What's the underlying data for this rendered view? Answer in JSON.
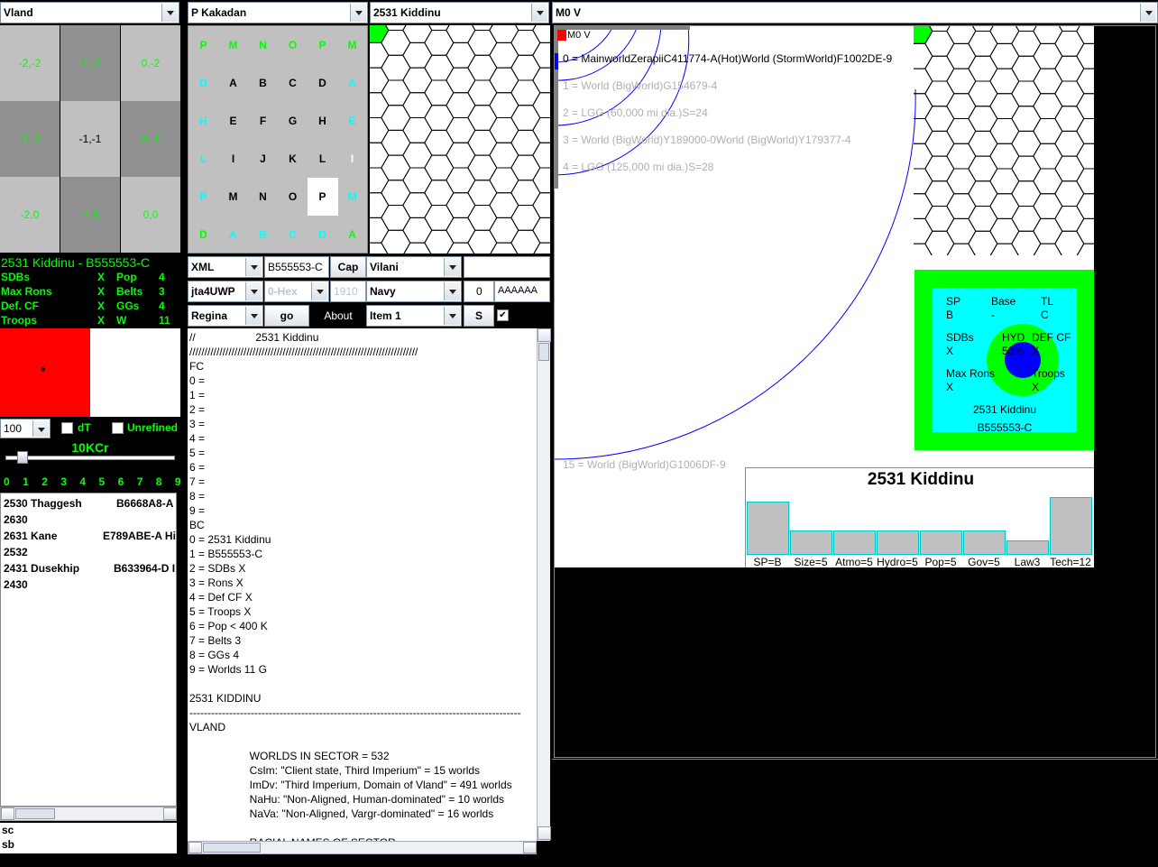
{
  "combos": {
    "sector": "Vland",
    "subsector": "P Kakadan",
    "hex": "2531 Kiddinu",
    "star": "M0 V"
  },
  "grid9": [
    {
      "label": "-2,-2",
      "color": "#00ff00",
      "bg": "#c0c0c0"
    },
    {
      "label": "-1,-2",
      "color": "#00ff00",
      "bg": "#909090"
    },
    {
      "label": "0,-2",
      "color": "#00ff00",
      "bg": "#c0c0c0"
    },
    {
      "label": "-2,-1",
      "color": "#00ff00",
      "bg": "#909090"
    },
    {
      "label": "-1,-1",
      "color": "#000000",
      "bg": "#c0c0c0"
    },
    {
      "label": "0,-1",
      "color": "#00ff00",
      "bg": "#909090"
    },
    {
      "label": "-2,0",
      "color": "#00ff00",
      "bg": "#c0c0c0"
    },
    {
      "label": "-1,0",
      "color": "#00ff00",
      "bg": "#909090"
    },
    {
      "label": "0,0",
      "color": "#00ff00",
      "bg": "#c0c0c0"
    }
  ],
  "letters": [
    [
      "P",
      "M",
      "N",
      "O",
      "P",
      "M"
    ],
    [
      "D",
      "A",
      "B",
      "C",
      "D",
      "A"
    ],
    [
      "H",
      "E",
      "F",
      "G",
      "H",
      "E"
    ],
    [
      "L",
      "I",
      "J",
      "K",
      "L",
      "I"
    ],
    [
      "P",
      "M",
      "N",
      "O",
      "P",
      "M"
    ],
    [
      "D",
      "A",
      "B",
      "C",
      "D",
      "A"
    ]
  ],
  "world_title": "2531 Kiddinu - B555553-C",
  "stats": [
    {
      "label": "SDBs",
      "x": "X",
      "k": "Pop",
      "v": "4"
    },
    {
      "label": "Max Rons",
      "x": "X",
      "k": "Belts",
      "v": "3"
    },
    {
      "label": "Def. CF",
      "x": "X",
      "k": "GGs",
      "v": "4"
    },
    {
      "label": "Troops",
      "x": "X",
      "k": "W",
      "v": "11"
    }
  ],
  "controls": {
    "amount": "100",
    "dT": "dT",
    "unrefined": "Unrefined",
    "credits": "10KCr",
    "slider_ticks": [
      "0",
      "1",
      "2",
      "3",
      "4",
      "5",
      "6",
      "7",
      "8",
      "9"
    ],
    "slider_value": 0.1
  },
  "worlds": [
    {
      "name": "2530 Thaggesh",
      "uwp": "B6668A8-A"
    },
    {
      "name": "2630",
      "uwp": ""
    },
    {
      "name": "2631 Kane",
      "uwp": "E789ABE-A Hi"
    },
    {
      "name": "2532",
      "uwp": ""
    },
    {
      "name": "2431 Dusekhip",
      "uwp": "B633964-D I"
    },
    {
      "name": "2430",
      "uwp": ""
    }
  ],
  "bottom_left": [
    "sc",
    "sb"
  ],
  "toolbar": {
    "format": "XML",
    "uwp": "B555553-C",
    "cap": "Cap",
    "race": "Vilani",
    "mode": "jta4UWP",
    "hex_opt": "0-Hex",
    "year": "1910",
    "service": "Navy",
    "count": "0",
    "code": "AAAAAA",
    "ship": "Regina",
    "go": "go",
    "about": "About",
    "item": "Item 1",
    "s": "S"
  },
  "text_lines": [
    "//                    2531 Kiddinu",
    "////////////////////////////////////////////////////////////////////////////",
    "FC",
    "0 =",
    "1 =",
    "2 =",
    "3 =",
    "4 =",
    "5 =",
    "6 =",
    "7 =",
    "8 =",
    "9 =",
    "BC",
    "0 = 2531 Kiddinu",
    "1 = B555553-C",
    "2 = SDBs X",
    "3 = Rons X",
    "4 = Def CF X",
    "5 = Troops X",
    "6 = Pop < 400 K",
    "7 = Belts 3",
    "8 = GGs 4",
    "9 = Worlds 11 G",
    "",
    "2531 KIDDINU",
    "--------------------------------------------------------------------------------------------",
    "VLAND",
    "",
    "                    WORLDS IN SECTOR = 532",
    "                    CsIm: \"Client state, Third Imperium\" = 15 worlds",
    "                    ImDv: \"Third Imperium, Domain of Vland\" = 491 worlds",
    "                    NaHu: \"Non-Aligned, Human-dominated\" = 10 worlds",
    "                    NaVa: \"Non-Aligned, Vargr-dominated\" = 16 worlds",
    "",
    "                    RACIAL NAMES OF SECTOR"
  ],
  "orbits": [
    {
      "text": "M0 V",
      "color": "#000000"
    },
    {
      "text": "0 = MainworldZerapiiC411774-A(Hot)World  (StormWorld)F1002DE-9",
      "color": "#000000"
    },
    {
      "text": "1 = World  (BigWorld)G154679-4",
      "color": "#b0b0b0"
    },
    {
      "text": "2 = LGG (60,000 mi dia.)S=24",
      "color": "#b0b0b0"
    },
    {
      "text": "3 = World  (BigWorld)Y189000-0World  (BigWorld)Y179377-4",
      "color": "#b0b0b0"
    },
    {
      "text": "4 = LGG (125,000 mi dia.)S=28",
      "color": "#b0b0b0"
    },
    {
      "text": "15 = World  (BigWorld)G1006DF-9",
      "color": "#b0b0b0"
    }
  ],
  "detail": {
    "sp_l": "SP",
    "sp_v": "B",
    "base_l": "Base",
    "base_v": "-",
    "tl_l": "TL",
    "tl_v": "C",
    "sdb_l": "SDBs",
    "sdb_v": "X",
    "hyd_l": "HYD",
    "hyd_v": "50%",
    "def_l": "DEF CF",
    "def_v": "X",
    "rons_l": "Max Rons",
    "rons_v": "X",
    "troops_l": "Troops",
    "troops_v": "X",
    "name": "2531 Kiddinu",
    "uwp": "B555553-C"
  },
  "chart_data": {
    "type": "bar",
    "title": "2531 Kiddinu",
    "categories": [
      "SP=B",
      "Size=5",
      "Atmo=5",
      "Hydro=5",
      "Pop=5",
      "Gov=5",
      "Law3",
      "Tech=12"
    ],
    "values": [
      11,
      5,
      5,
      5,
      5,
      5,
      3,
      12
    ],
    "ylim": [
      0,
      12
    ]
  }
}
